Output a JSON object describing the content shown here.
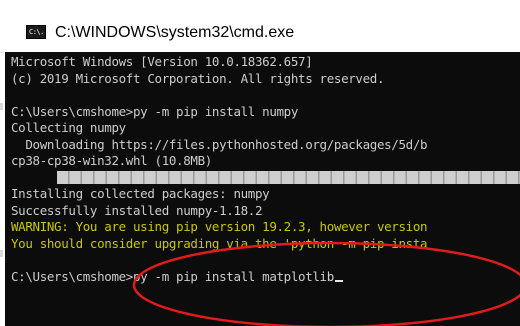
{
  "window": {
    "title": "C:\\WINDOWS\\system32\\cmd.exe",
    "icon": "cmd-console-icon",
    "icon_text": "C:\\."
  },
  "console": {
    "lines": [
      "Microsoft Windows [Version 10.0.18362.657]",
      "(c) 2019 Microsoft Corporation. All rights reserved.",
      "",
      "C:\\Users\\cmshome>py -m pip install numpy",
      "Collecting numpy",
      "  Downloading https://files.pythonhosted.org/packages/5d/b",
      "cp38-cp38-win32.whl (10.8MB)",
      "Installing collected packages: numpy",
      "Successfully installed numpy-1.18.2",
      "WARNING: You are using pip version 19.2.3, however version",
      "You should consider upgrading via the 'python -m pip insta",
      "",
      "C:\\Users\\cmshome>py -m pip install matplotlib"
    ],
    "download_progress": 1.0
  },
  "colors": {
    "console_bg": "#0c0c0c",
    "console_text": "#cccccc",
    "warning_text": "#c8c800",
    "annotation_ellipse": "#e11b1b"
  }
}
